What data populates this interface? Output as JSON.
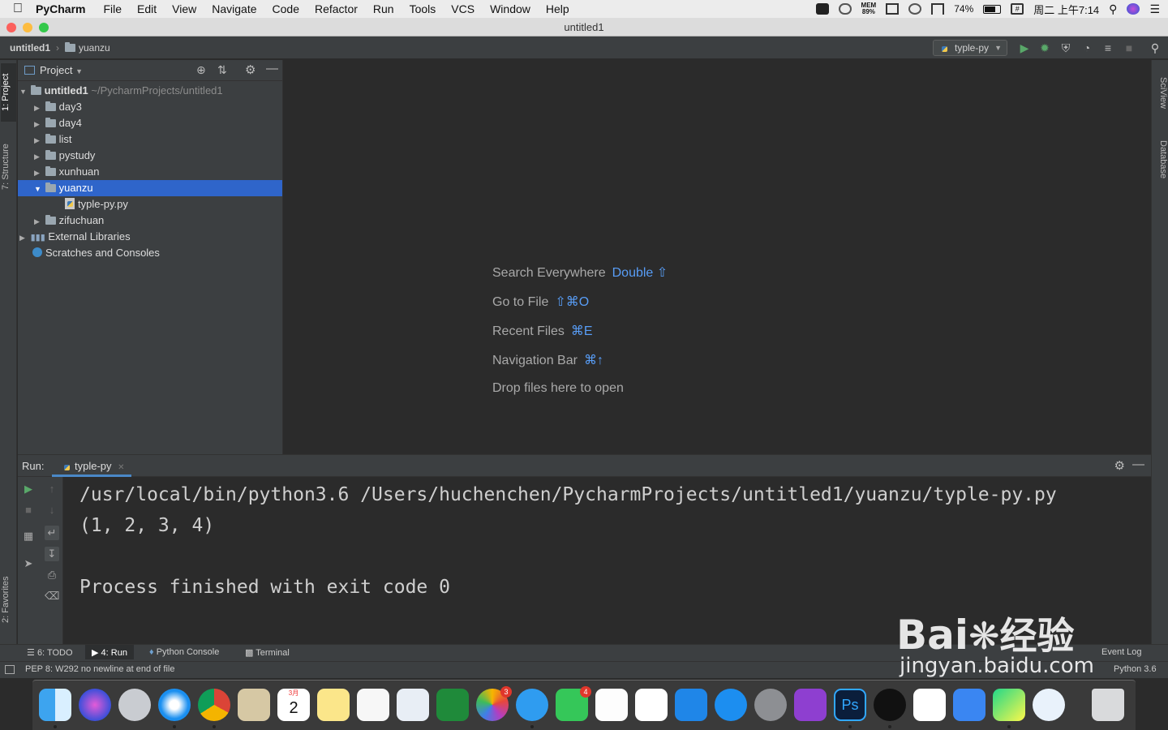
{
  "menubar": {
    "app_name": "PyCharm",
    "items": [
      "File",
      "Edit",
      "View",
      "Navigate",
      "Code",
      "Refactor",
      "Run",
      "Tools",
      "VCS",
      "Window",
      "Help"
    ],
    "mem_label": "MEM",
    "mem_value": "89%",
    "battery": "74%",
    "battery_level": 0.74,
    "clock": "周二 上午7:14"
  },
  "window": {
    "title": "untitled1"
  },
  "navbar": {
    "crumb_project": "untitled1",
    "crumb_folder": "yuanzu",
    "run_config": "typle-py"
  },
  "left_strip": {
    "project_tab": "1: Project",
    "structure_tab": "7: Structure",
    "favorites_tab": "2: Favorites"
  },
  "right_strip": {
    "sciview_tab": "SciView",
    "database_tab": "Database"
  },
  "project_panel": {
    "title": "Project",
    "tree": [
      {
        "label": "untitled1",
        "path": "~/PycharmProjects/untitled1"
      },
      {
        "label": "day3"
      },
      {
        "label": "day4"
      },
      {
        "label": "list"
      },
      {
        "label": "pystudy"
      },
      {
        "label": "xunhuan"
      },
      {
        "label": "yuanzu"
      },
      {
        "label": "typle-py.py"
      },
      {
        "label": "zifuchuan"
      },
      {
        "label": "External Libraries"
      },
      {
        "label": "Scratches and Consoles"
      }
    ]
  },
  "editor": {
    "hints": [
      {
        "text": "Search Everywhere",
        "key": "Double ⇧"
      },
      {
        "text": "Go to File",
        "key": "⇧⌘O"
      },
      {
        "text": "Recent Files",
        "key": "⌘E"
      },
      {
        "text": "Navigation Bar",
        "key": "⌘↑"
      },
      {
        "text": "Drop files here to open",
        "key": ""
      }
    ]
  },
  "run_panel": {
    "label": "Run:",
    "tab": "typle-py",
    "output": [
      "/usr/local/bin/python3.6 /Users/huchenchen/PycharmProjects/untitled1/yuanzu/typle-py.py",
      "(1, 2, 3, 4)",
      "",
      "Process finished with exit code 0"
    ]
  },
  "bottom_tabs": {
    "todo": "6: TODO",
    "run": "4: Run",
    "python_console": "Python Console",
    "terminal": "Terminal",
    "event_log": "Event Log"
  },
  "statusbar": {
    "message": "PEP 8: W292 no newline at end of file",
    "interpreter": "Python 3.6"
  },
  "dock": {
    "calendar_month": "3月",
    "calendar_day": "2",
    "photos_badge": "3",
    "facetime_badge": "4"
  },
  "watermark": {
    "brand": "Bai",
    "brand_cn": "经验",
    "url": "jingyan.baidu.com"
  },
  "colors": {
    "selection": "#2f65ca",
    "shortcut": "#589df6",
    "run_green": "#59a869",
    "editor_bg": "#2b2b2b",
    "panel_bg": "#3c3f41"
  }
}
